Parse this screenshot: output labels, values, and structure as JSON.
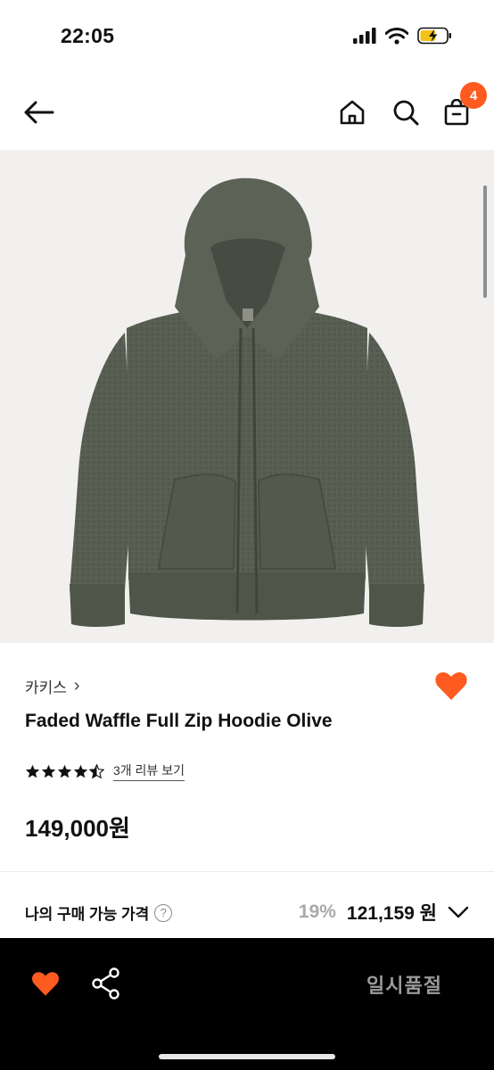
{
  "status_bar": {
    "time": "22:05"
  },
  "header": {
    "cart_count": "4"
  },
  "product": {
    "brand": "카키스",
    "brand_chevron": "›",
    "name": "Faded Waffle Full Zip Hoodie Olive",
    "rating": 4.5,
    "rating_max": 5,
    "review_link": "3개 리뷰 보기",
    "price": "149,000원"
  },
  "purchase_price": {
    "label": "나의 구매 가능 가격",
    "help": "?",
    "discount": "19%",
    "price": "121,159 원"
  },
  "bottom_bar": {
    "status": "일시품절"
  },
  "colors": {
    "accent": "#ff5a1f",
    "hoodie": "#5a6154",
    "image_bg": "#f1f0ef"
  }
}
